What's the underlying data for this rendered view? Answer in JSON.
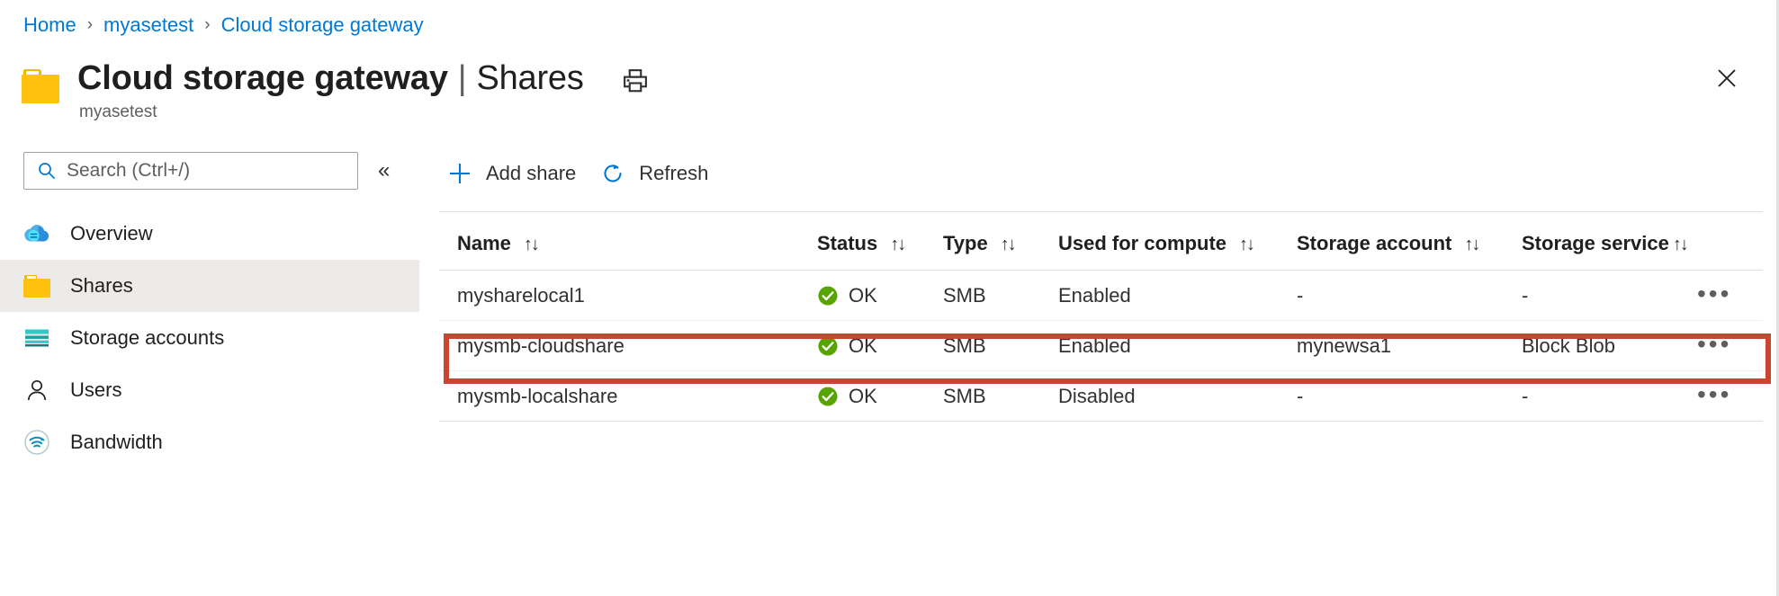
{
  "breadcrumb": {
    "items": [
      "Home",
      "myasetest",
      "Cloud storage gateway"
    ],
    "separator": "›"
  },
  "header": {
    "icon": "folder-icon",
    "title": "Cloud storage gateway",
    "separator": "|",
    "subpage": "Shares",
    "resource_name": "myasetest",
    "print_icon": "print-icon",
    "close_icon": "close-icon"
  },
  "sidebar": {
    "search": {
      "placeholder": "Search (Ctrl+/)",
      "value": "",
      "icon": "search-icon"
    },
    "collapse": {
      "label": "«",
      "icon": "chevron-double-left-icon"
    },
    "items": [
      {
        "label": "Overview",
        "icon": "cloud-icon",
        "selected": false
      },
      {
        "label": "Shares",
        "icon": "folder-icon",
        "selected": true
      },
      {
        "label": "Storage accounts",
        "icon": "storage-account-icon",
        "selected": false
      },
      {
        "label": "Users",
        "icon": "user-icon",
        "selected": false
      },
      {
        "label": "Bandwidth",
        "icon": "bandwidth-icon",
        "selected": false
      }
    ]
  },
  "toolbar": {
    "add_share_label": "Add share",
    "add_share_icon": "plus-icon",
    "refresh_label": "Refresh",
    "refresh_icon": "refresh-icon"
  },
  "table": {
    "sort_glyph": "↑↓",
    "columns": [
      {
        "label": "Name",
        "sortable": true
      },
      {
        "label": "Status",
        "sortable": true
      },
      {
        "label": "Type",
        "sortable": true
      },
      {
        "label": "Used for compute",
        "sortable": true
      },
      {
        "label": "Storage account",
        "sortable": true
      },
      {
        "label": "Storage service",
        "sortable": true
      },
      {
        "label": "",
        "sortable": false
      }
    ],
    "rows": [
      {
        "name": "mysharelocal1",
        "status": "OK",
        "status_icon": "success-check-icon",
        "type": "SMB",
        "used_for_compute": "Enabled",
        "storage_account": "-",
        "storage_service": "-",
        "actions": "•••",
        "highlighted": false
      },
      {
        "name": "mysmb-cloudshare",
        "status": "OK",
        "status_icon": "success-check-icon",
        "type": "SMB",
        "used_for_compute": "Enabled",
        "storage_account": "mynewsa1",
        "storage_service": "Block Blob",
        "actions": "•••",
        "highlighted": true
      },
      {
        "name": "mysmb-localshare",
        "status": "OK",
        "status_icon": "success-check-icon",
        "type": "SMB",
        "used_for_compute": "Disabled",
        "storage_account": "-",
        "storage_service": "-",
        "actions": "•••",
        "highlighted": false
      }
    ]
  },
  "colors": {
    "link": "#0078d4",
    "accent": "#0078d4",
    "folder_yellow": "#ffc20e",
    "status_green": "#57a300",
    "highlight_red": "#c9452f",
    "text_primary": "#201f1e",
    "text_secondary": "#605e5c",
    "selected_row_bg": "#edebe9"
  }
}
